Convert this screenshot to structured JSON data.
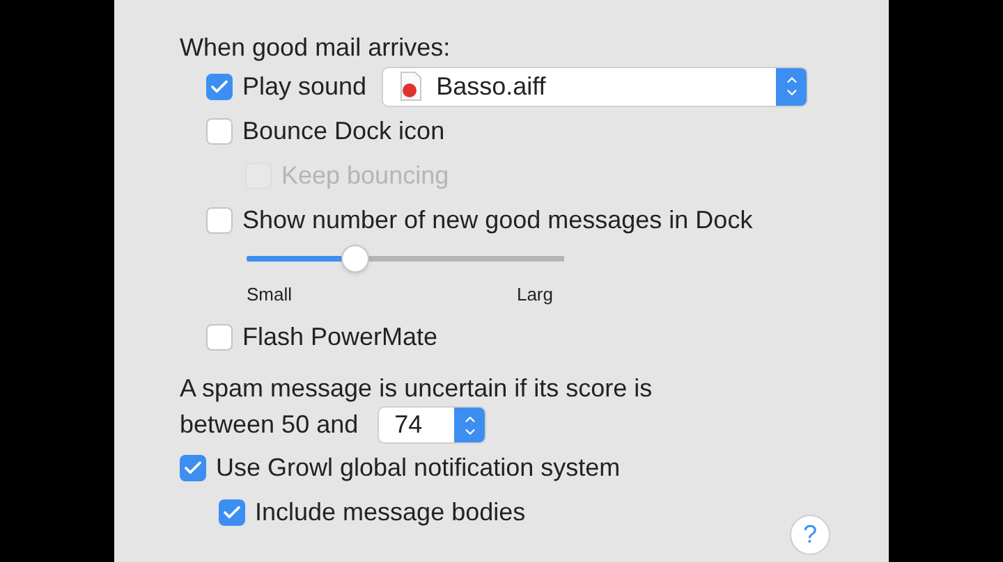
{
  "good_mail": {
    "heading": "When good mail arrives:",
    "items": [
      {
        "kind": "checkbox",
        "label": "Play sound",
        "checked": true,
        "disabled": false,
        "popup": {
          "value": "Basso.aiff"
        }
      },
      {
        "kind": "checkbox",
        "label": "Bounce Dock icon",
        "checked": false,
        "disabled": false,
        "children": [
          {
            "kind": "checkbox",
            "label": "Keep bouncing",
            "checked": false,
            "disabled": true
          }
        ]
      },
      {
        "kind": "checkbox",
        "label": "Show number of new good messages in Dock",
        "checked": false,
        "disabled": false
      },
      {
        "kind": "slider",
        "level": 0.34,
        "min_label": "Small",
        "max_label": "Larg"
      },
      {
        "kind": "checkbox",
        "label": "Flash PowerMate",
        "checked": false,
        "disabled": false
      }
    ]
  },
  "spam": {
    "label_lines": [
      "A spam message is uncertain if its score is",
      "between 50 and"
    ],
    "value": "74"
  },
  "notifications": [
    {
      "kind": "checkbox",
      "label": "Use Growl global notification system",
      "checked": true,
      "disabled": false,
      "children": [
        {
          "kind": "checkbox",
          "label": "Include message bodies",
          "checked": true,
          "disabled": false
        }
      ]
    }
  ],
  "help": {
    "label": "?"
  }
}
